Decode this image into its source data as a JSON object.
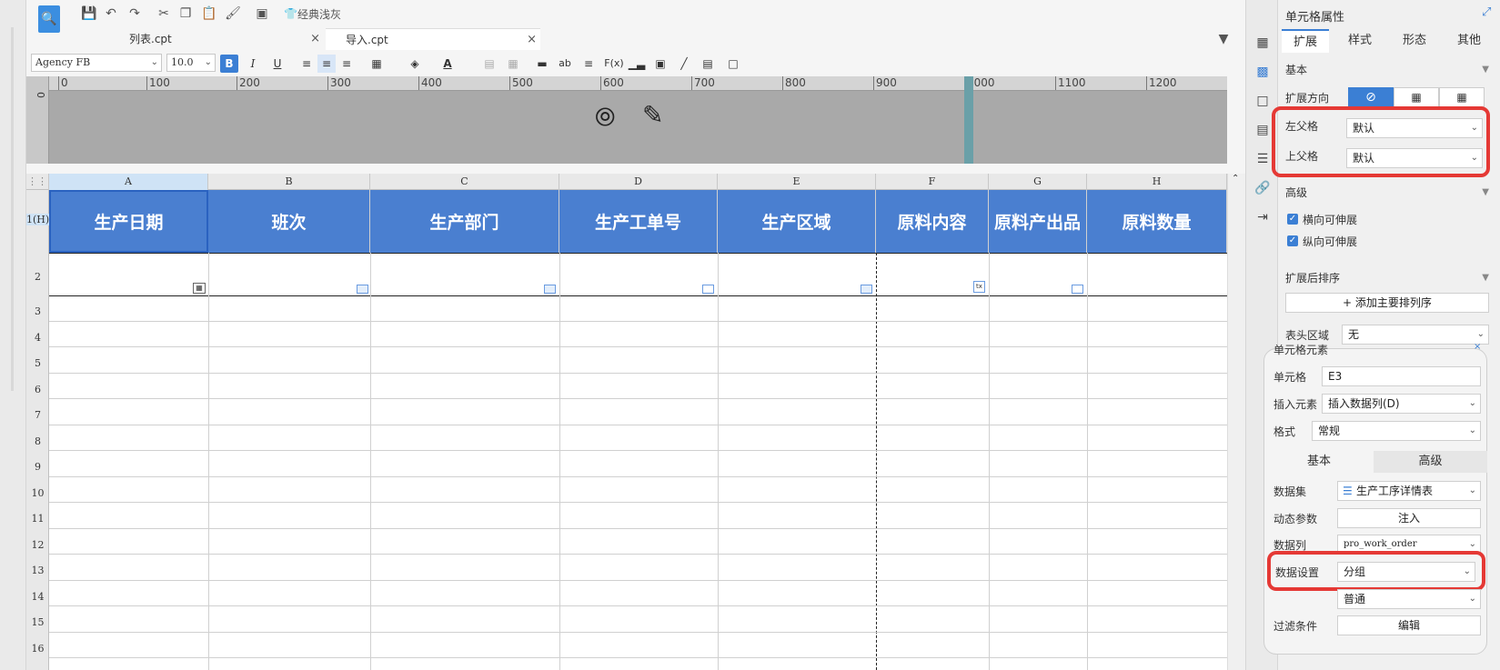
{
  "toolbar": {
    "theme_label": "经典浅灰"
  },
  "tabs": [
    {
      "label": "列表.cpt",
      "close": "×"
    },
    {
      "label": "导入.cpt",
      "close": "×"
    }
  ],
  "format": {
    "font_name": "Agency FB",
    "font_size": "10.0",
    "bold": "B",
    "italic": "I",
    "underline": "U",
    "font_color": "A",
    "ab": "ab",
    "fx": "F(x)"
  },
  "ruler": {
    "ticks": [
      "0",
      "100",
      "200",
      "300",
      "400",
      "500",
      "600",
      "700",
      "800",
      "900",
      "1000",
      "1100",
      "1200"
    ],
    "vertical_zero": "0"
  },
  "columns": [
    "A",
    "B",
    "C",
    "D",
    "E",
    "F",
    "G",
    "H"
  ],
  "header_cells": [
    "生产日期",
    "班次",
    "生产部门",
    "生产工单号",
    "生产区域",
    "原料内容",
    "原料产出品",
    "原料数量"
  ],
  "rows": [
    "1(H)",
    "2",
    "3",
    "4",
    "5",
    "6",
    "7",
    "8",
    "9",
    "10",
    "11",
    "12",
    "13",
    "14",
    "15",
    "16"
  ],
  "panel": {
    "title": "单元格属性",
    "tabs": [
      "扩展",
      "样式",
      "形态",
      "其他"
    ],
    "basic_section": "基本",
    "expand_direction_label": "扩展方向",
    "left_parent_label": "左父格",
    "left_parent_value": "默认",
    "top_parent_label": "上父格",
    "top_parent_value": "默认",
    "advanced_section": "高级",
    "horizontal_expand": "横向可伸展",
    "vertical_expand": "纵向可伸展",
    "sort_section": "扩展后排序",
    "add_sort_button": "添加主要排列序",
    "header_area_label": "表头区域",
    "header_area_value": "无"
  },
  "dialog": {
    "title": "单元格元素",
    "cell_label": "单元格",
    "cell_value": "E3",
    "insert_label": "插入元素",
    "insert_value": "插入数据列(D)",
    "format_label": "格式",
    "format_value": "常规",
    "tab_basic": "基本",
    "tab_advanced": "高级",
    "dataset_label": "数据集",
    "dataset_value": "生产工序详情表",
    "dynamic_param_label": "动态参数",
    "inject_button": "注入",
    "data_column_label": "数据列",
    "data_column_value": "pro_work_order",
    "data_setting_label": "数据设置",
    "data_setting_value": "分组",
    "normal_value": "普通",
    "filter_label": "过滤条件",
    "edit_button": "编辑"
  },
  "colors": {
    "header_blue": "#4a7fd0",
    "highlight_red": "#e53935",
    "checkbox_blue": "#3b7fd4"
  }
}
